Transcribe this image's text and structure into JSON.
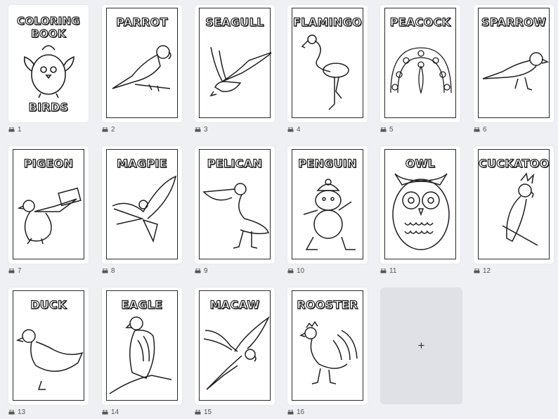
{
  "pages": [
    {
      "num": "1",
      "title": "COLORING BOOK",
      "subtitle": "BIRDS"
    },
    {
      "num": "2",
      "title": "PARROT"
    },
    {
      "num": "3",
      "title": "SEAGULL"
    },
    {
      "num": "4",
      "title": "FLAMINGO"
    },
    {
      "num": "5",
      "title": "PEACOCK"
    },
    {
      "num": "6",
      "title": "SPARROW"
    },
    {
      "num": "7",
      "title": "PIGEON"
    },
    {
      "num": "8",
      "title": "MAGPIE"
    },
    {
      "num": "9",
      "title": "PELICAN"
    },
    {
      "num": "10",
      "title": "PENGUIN"
    },
    {
      "num": "11",
      "title": "OWL"
    },
    {
      "num": "12",
      "title": "CUCKATOO"
    },
    {
      "num": "13",
      "title": "DUCK"
    },
    {
      "num": "14",
      "title": "EAGLE"
    },
    {
      "num": "15",
      "title": "MACAW"
    },
    {
      "num": "16",
      "title": "ROOSTER"
    }
  ],
  "add_tile": {
    "label": "+"
  },
  "icons": {
    "page_number_icon": "printer-icon",
    "add_icon": "plus-icon"
  }
}
